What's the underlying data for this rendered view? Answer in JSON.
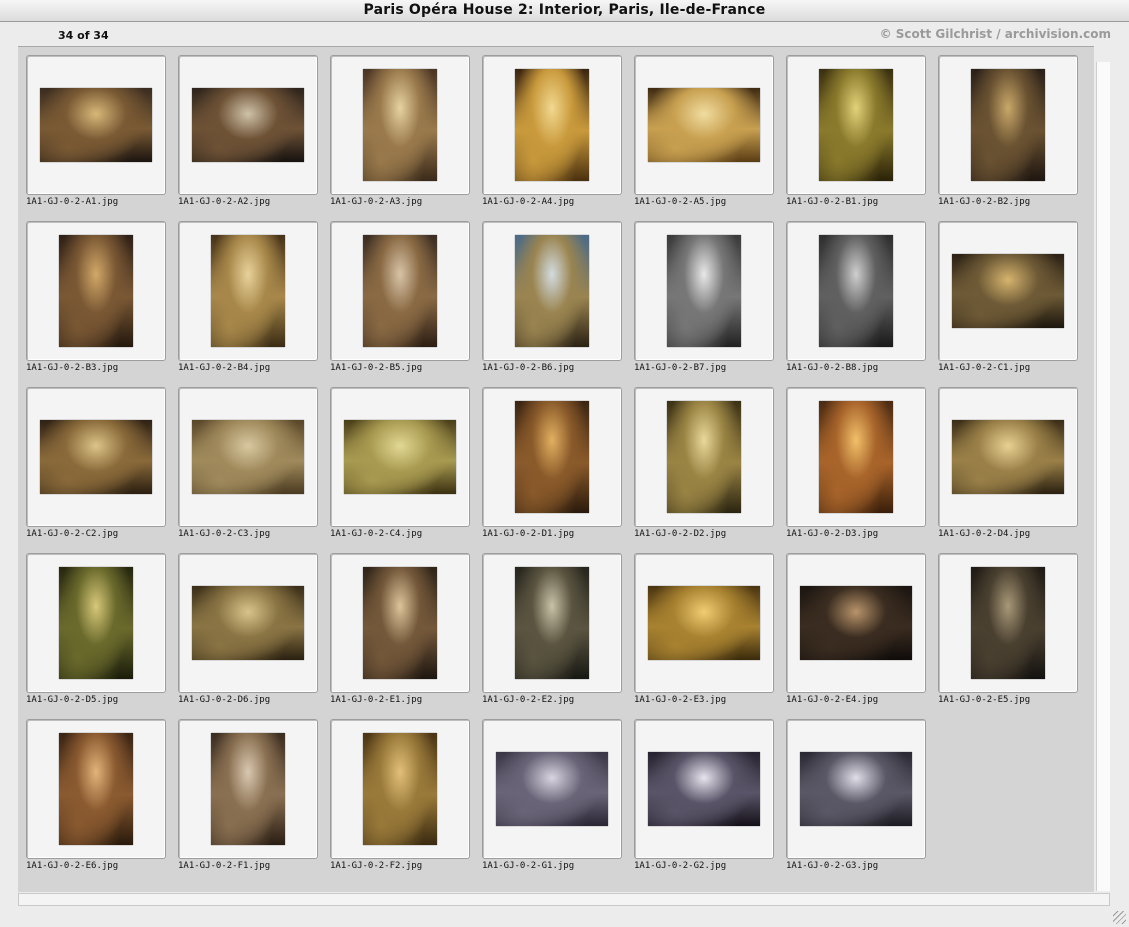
{
  "window": {
    "title": "Paris Opéra House 2: Interior, Paris, Ile-de-France"
  },
  "header": {
    "count": "34 of 34",
    "credit": "© Scott Gilchrist / archivision.com"
  },
  "thumbnails": [
    {
      "file": "1A1-GJ-0-2-A1.jpg",
      "orientation": "landscape",
      "colors": [
        "#1b1410",
        "#7a5a34",
        "#d8b878",
        "#3a2c20"
      ]
    },
    {
      "file": "1A1-GJ-0-2-A2.jpg",
      "orientation": "landscape",
      "colors": [
        "#161210",
        "#6e5236",
        "#cfc2a8",
        "#2e241c"
      ]
    },
    {
      "file": "1A1-GJ-0-2-A3.jpg",
      "orientation": "portrait",
      "colors": [
        "#3a2a1a",
        "#9a7a4c",
        "#e6d2a2",
        "#4a3424"
      ]
    },
    {
      "file": "1A1-GJ-0-2-A4.jpg",
      "orientation": "portrait",
      "colors": [
        "#4a300e",
        "#c99a3c",
        "#f2d890",
        "#3a2410"
      ]
    },
    {
      "file": "1A1-GJ-0-2-A5.jpg",
      "orientation": "landscape",
      "colors": [
        "#5a3c14",
        "#c8a050",
        "#f0dca0",
        "#3e2a12"
      ]
    },
    {
      "file": "1A1-GJ-0-2-B1.jpg",
      "orientation": "portrait",
      "colors": [
        "#2a2208",
        "#8a7a2c",
        "#e2d27a",
        "#3a3010"
      ]
    },
    {
      "file": "1A1-GJ-0-2-B2.jpg",
      "orientation": "portrait",
      "colors": [
        "#1e1610",
        "#6a5232",
        "#c8a868",
        "#2a2018"
      ]
    },
    {
      "file": "1A1-GJ-0-2-B3.jpg",
      "orientation": "portrait",
      "colors": [
        "#24180e",
        "#7a5834",
        "#d2a868",
        "#2e2016"
      ]
    },
    {
      "file": "1A1-GJ-0-2-B4.jpg",
      "orientation": "portrait",
      "colors": [
        "#3a2c14",
        "#a8884a",
        "#e8d29a",
        "#463218"
      ]
    },
    {
      "file": "1A1-GJ-0-2-B5.jpg",
      "orientation": "portrait",
      "colors": [
        "#2c1e14",
        "#8a6a44",
        "#d8c4a8",
        "#3a2c22"
      ]
    },
    {
      "file": "1A1-GJ-0-2-B6.jpg",
      "orientation": "portrait",
      "colors": [
        "#2a2214",
        "#9a8450",
        "#d2dce0",
        "#4a6a88"
      ]
    },
    {
      "file": "1A1-GJ-0-2-B7.jpg",
      "orientation": "portrait",
      "colors": [
        "#222222",
        "#777777",
        "#e8e8e8",
        "#3a3a3a"
      ]
    },
    {
      "file": "1A1-GJ-0-2-B8.jpg",
      "orientation": "portrait",
      "colors": [
        "#1a1a1a",
        "#606060",
        "#cfcfcf",
        "#2e2e2e"
      ]
    },
    {
      "file": "1A1-GJ-0-2-C1.jpg",
      "orientation": "landscape",
      "colors": [
        "#1c160e",
        "#6e5a36",
        "#d6b46e",
        "#2a2014"
      ]
    },
    {
      "file": "1A1-GJ-0-2-C2.jpg",
      "orientation": "landscape",
      "colors": [
        "#2a1e10",
        "#8a6a3a",
        "#dcc488",
        "#2e2014"
      ]
    },
    {
      "file": "1A1-GJ-0-2-C3.jpg",
      "orientation": "landscape",
      "colors": [
        "#4a3a20",
        "#a08a5c",
        "#d8c8a0",
        "#5a4628"
      ]
    },
    {
      "file": "1A1-GJ-0-2-C4.jpg",
      "orientation": "landscape",
      "colors": [
        "#3a3010",
        "#a89a50",
        "#e2d894",
        "#4a3e18"
      ]
    },
    {
      "file": "1A1-GJ-0-2-D1.jpg",
      "orientation": "portrait",
      "colors": [
        "#2a1a0c",
        "#8a5a2a",
        "#e2b060",
        "#3a2412"
      ]
    },
    {
      "file": "1A1-GJ-0-2-D2.jpg",
      "orientation": "portrait",
      "colors": [
        "#2a2410",
        "#9a8444",
        "#e8d89a",
        "#3a3014"
      ]
    },
    {
      "file": "1A1-GJ-0-2-D3.jpg",
      "orientation": "portrait",
      "colors": [
        "#3a1e0a",
        "#a8642a",
        "#f2c06a",
        "#4a2a12"
      ]
    },
    {
      "file": "1A1-GJ-0-2-D4.jpg",
      "orientation": "landscape",
      "colors": [
        "#2a2010",
        "#9a8048",
        "#e8d092",
        "#3a2c16"
      ]
    },
    {
      "file": "1A1-GJ-0-2-D5.jpg",
      "orientation": "portrait",
      "colors": [
        "#1a1c0a",
        "#6a6a2c",
        "#d8c87a",
        "#262610"
      ]
    },
    {
      "file": "1A1-GJ-0-2-D6.jpg",
      "orientation": "landscape",
      "colors": [
        "#2a2010",
        "#8a7444",
        "#d8c48a",
        "#3a2e18"
      ]
    },
    {
      "file": "1A1-GJ-0-2-E1.jpg",
      "orientation": "portrait",
      "colors": [
        "#1e1610",
        "#74583a",
        "#dcc49a",
        "#2e2418"
      ]
    },
    {
      "file": "1A1-GJ-0-2-E2.jpg",
      "orientation": "portrait",
      "colors": [
        "#181814",
        "#5a5440",
        "#c8c2a8",
        "#26241c"
      ]
    },
    {
      "file": "1A1-GJ-0-2-E3.jpg",
      "orientation": "landscape",
      "colors": [
        "#3a2a0c",
        "#a88230",
        "#f0cc72",
        "#4a3410"
      ]
    },
    {
      "file": "1A1-GJ-0-2-E4.jpg",
      "orientation": "landscape",
      "colors": [
        "#100c0a",
        "#3a2c20",
        "#b8946a",
        "#1a1410"
      ]
    },
    {
      "file": "1A1-GJ-0-2-E5.jpg",
      "orientation": "portrait",
      "colors": [
        "#141210",
        "#4a4030",
        "#a89878",
        "#1e1a14"
      ]
    },
    {
      "file": "1A1-GJ-0-2-E6.jpg",
      "orientation": "portrait",
      "colors": [
        "#2a1a0c",
        "#8a5a30",
        "#e2b47a",
        "#3a2414"
      ]
    },
    {
      "file": "1A1-GJ-0-2-F1.jpg",
      "orientation": "portrait",
      "colors": [
        "#2a1e14",
        "#8a7052",
        "#d8c8b0",
        "#3a2c20"
      ]
    },
    {
      "file": "1A1-GJ-0-2-F2.jpg",
      "orientation": "portrait",
      "colors": [
        "#3a2a10",
        "#9a7a3a",
        "#e2c07a",
        "#4a3414"
      ]
    },
    {
      "file": "1A1-GJ-0-2-G1.jpg",
      "orientation": "landscape",
      "colors": [
        "#2a2634",
        "#6a6478",
        "#d8d4e0",
        "#3a3646"
      ]
    },
    {
      "file": "1A1-GJ-0-2-G2.jpg",
      "orientation": "landscape",
      "colors": [
        "#141018",
        "#5a5468",
        "#e6e4ee",
        "#26222e"
      ]
    },
    {
      "file": "1A1-GJ-0-2-G3.jpg",
      "orientation": "landscape",
      "colors": [
        "#1c1a22",
        "#5a5866",
        "#e0dee8",
        "#2a2832"
      ]
    }
  ]
}
